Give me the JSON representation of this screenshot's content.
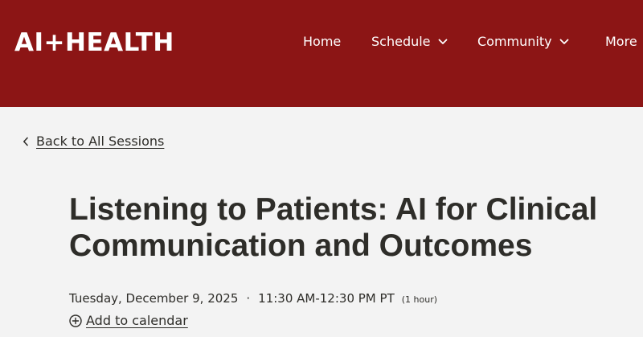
{
  "header": {
    "logo": "AI+HEALTH",
    "bg_color": "#8c1515",
    "nav": [
      {
        "label": "Home",
        "icon": null
      },
      {
        "label": "Schedule",
        "icon": "chevron-down-icon"
      },
      {
        "label": "Community",
        "icon": "chevron-down-icon"
      },
      {
        "label": "More",
        "icon": null
      }
    ]
  },
  "back_link": {
    "label": "Back to All Sessions",
    "icon": "chevron-left-icon"
  },
  "session": {
    "title": "Listening to Patients: AI for Clinical Communication and Outcomes",
    "date": "Tuesday, December 9, 2025",
    "separator": "·",
    "time": "11:30 AM-12:30 PM PT",
    "duration": "(1 hour)"
  },
  "add_to_calendar": {
    "label": "Add to calendar",
    "icon": "plus-circle-icon"
  }
}
